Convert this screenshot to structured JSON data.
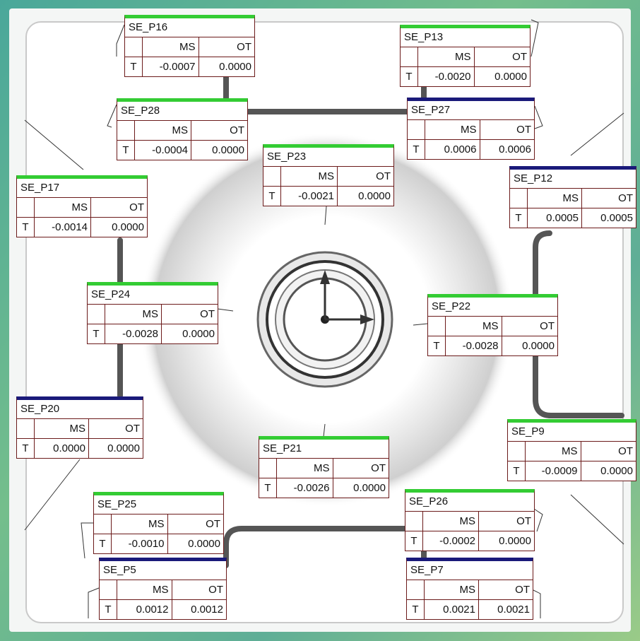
{
  "header_ms": "MS",
  "header_ot": "OT",
  "row_label": "T",
  "colors": {
    "green_bar": "#33cc33",
    "navy_bar": "#1a1a7a",
    "border": "#6b1a1a"
  },
  "annotations": [
    {
      "id": "p16",
      "name": "SE_P16",
      "ms": "-0.0007",
      "ot": "0.0000",
      "bar": "green"
    },
    {
      "id": "p13",
      "name": "SE_P13",
      "ms": "-0.0020",
      "ot": "0.0000",
      "bar": "green"
    },
    {
      "id": "p28",
      "name": "SE_P28",
      "ms": "-0.0004",
      "ot": "0.0000",
      "bar": "green"
    },
    {
      "id": "p27",
      "name": "SE_P27",
      "ms": "0.0006",
      "ot": "0.0006",
      "bar": "navy"
    },
    {
      "id": "p23",
      "name": "SE_P23",
      "ms": "-0.0021",
      "ot": "0.0000",
      "bar": "green"
    },
    {
      "id": "p17",
      "name": "SE_P17",
      "ms": "-0.0014",
      "ot": "0.0000",
      "bar": "green"
    },
    {
      "id": "p12",
      "name": "SE_P12",
      "ms": "0.0005",
      "ot": "0.0005",
      "bar": "navy"
    },
    {
      "id": "p24",
      "name": "SE_P24",
      "ms": "-0.0028",
      "ot": "0.0000",
      "bar": "green"
    },
    {
      "id": "p22",
      "name": "SE_P22",
      "ms": "-0.0028",
      "ot": "0.0000",
      "bar": "green"
    },
    {
      "id": "p20",
      "name": "SE_P20",
      "ms": "0.0000",
      "ot": "0.0000",
      "bar": "navy"
    },
    {
      "id": "p9",
      "name": "SE_P9",
      "ms": "-0.0009",
      "ot": "0.0000",
      "bar": "green"
    },
    {
      "id": "p21",
      "name": "SE_P21",
      "ms": "-0.0026",
      "ot": "0.0000",
      "bar": "green"
    },
    {
      "id": "p25",
      "name": "SE_P25",
      "ms": "-0.0010",
      "ot": "0.0000",
      "bar": "green"
    },
    {
      "id": "p26",
      "name": "SE_P26",
      "ms": "-0.0002",
      "ot": "0.0000",
      "bar": "green"
    },
    {
      "id": "p5",
      "name": "SE_P5",
      "ms": "0.0012",
      "ot": "0.0012",
      "bar": "navy"
    },
    {
      "id": "p7",
      "name": "SE_P7",
      "ms": "0.0021",
      "ot": "0.0021",
      "bar": "navy"
    }
  ]
}
